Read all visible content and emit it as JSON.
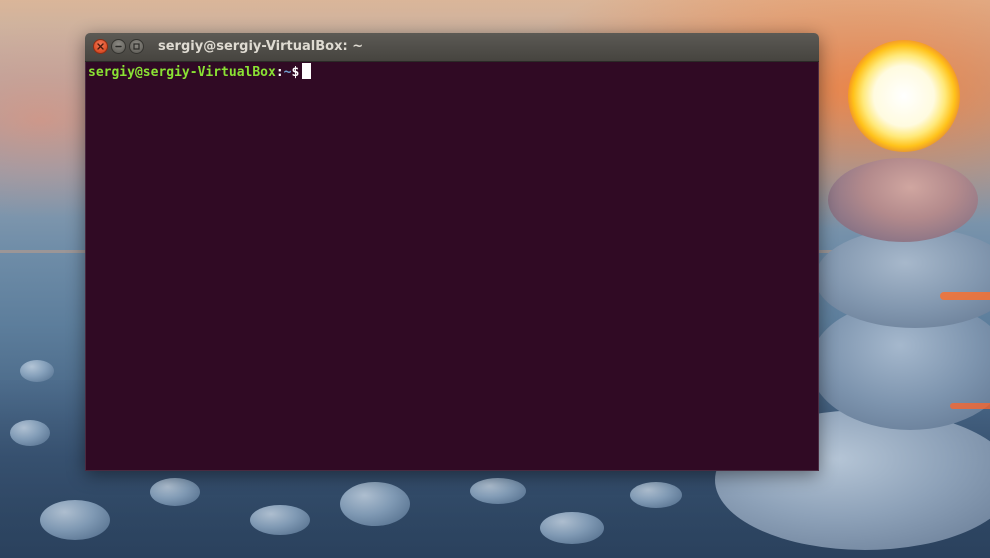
{
  "window": {
    "title": "sergiy@sergiy-VirtualBox: ~",
    "buttons": {
      "close": "close-icon",
      "minimize": "minimize-icon",
      "maximize": "maximize-icon"
    }
  },
  "terminal": {
    "prompt_user_host": "sergiy@sergiy-VirtualBox",
    "prompt_separator": ":",
    "prompt_path": "~",
    "prompt_symbol": "$",
    "input": ""
  },
  "colors": {
    "terminal_background": "#300a24",
    "prompt_user_host": "#8ae234",
    "prompt_path": "#729fcf",
    "close_button": "#e0532c"
  }
}
